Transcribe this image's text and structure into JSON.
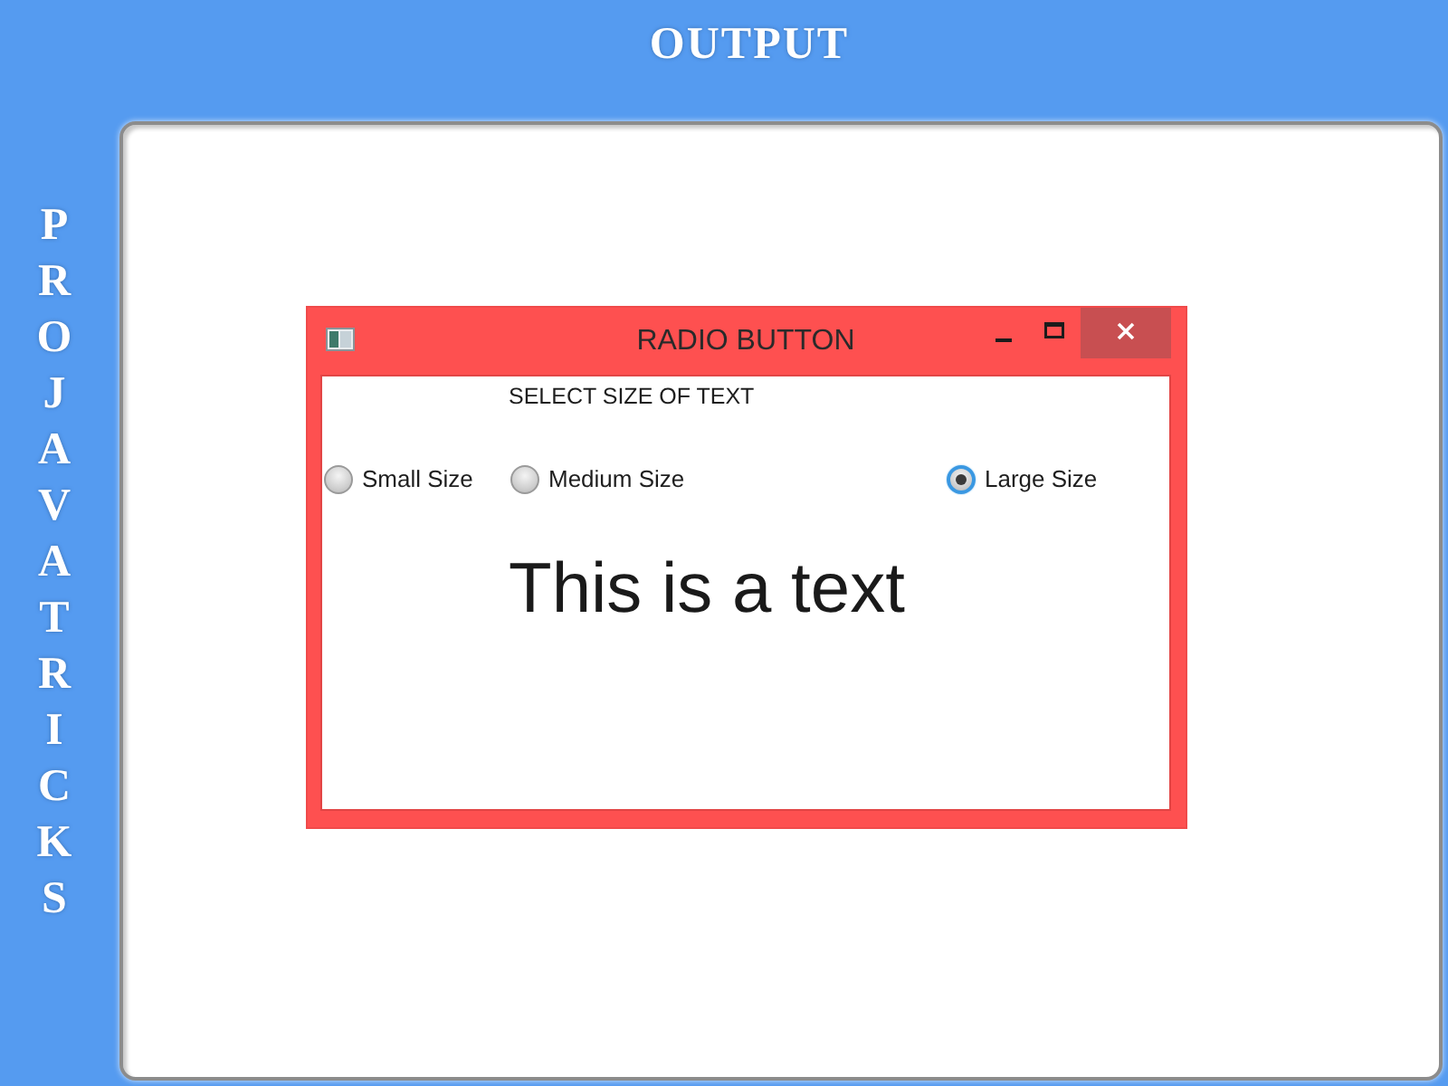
{
  "page": {
    "title": "OUTPUT",
    "side_text": "PRO JAVA TRICKS"
  },
  "window": {
    "title": "RADIO BUTTON",
    "heading": "SELECT SIZE OF TEXT",
    "options": [
      {
        "label": "Small Size",
        "selected": false
      },
      {
        "label": "Medium Size",
        "selected": false
      },
      {
        "label": "Large Size",
        "selected": true
      }
    ],
    "sample_text": "This is a text"
  }
}
